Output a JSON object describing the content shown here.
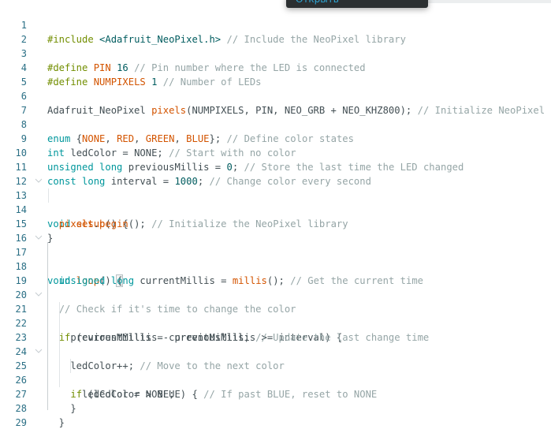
{
  "tooltip": {
    "label": "Открыть"
  },
  "editor": {
    "lines": [
      {
        "n": "1"
      },
      {
        "n": "2"
      },
      {
        "n": "3"
      },
      {
        "n": "4"
      },
      {
        "n": "5"
      },
      {
        "n": "6"
      },
      {
        "n": "7"
      },
      {
        "n": "8"
      },
      {
        "n": "9"
      },
      {
        "n": "10"
      },
      {
        "n": "11"
      },
      {
        "n": "12"
      },
      {
        "n": "13"
      },
      {
        "n": "14"
      },
      {
        "n": "15"
      },
      {
        "n": "16"
      },
      {
        "n": "17"
      },
      {
        "n": "18"
      },
      {
        "n": "19"
      },
      {
        "n": "20"
      },
      {
        "n": "21"
      },
      {
        "n": "22"
      },
      {
        "n": "23"
      },
      {
        "n": "24"
      },
      {
        "n": "25"
      },
      {
        "n": "26"
      },
      {
        "n": "27"
      },
      {
        "n": "28"
      },
      {
        "n": "29"
      }
    ],
    "code": {
      "l1": {
        "a": "#include",
        "b": " <Adafruit_NeoPixel.h>",
        "c": " // Include the NeoPixel library"
      },
      "l3": {
        "a": "#define",
        "b": " PIN",
        "c": " 16",
        "d": " // Pin number where the LED is connected"
      },
      "l4": {
        "a": "#define",
        "b": " NUMPIXELS",
        "c": " 1",
        "d": " // Number of LEDs"
      },
      "l6": {
        "a": "Adafruit_NeoPixel ",
        "b": "pixels",
        "c": "(NUMPIXELS, PIN, NEO_GRB + NEO_KHZ800);",
        "d": " // Initialize NeoPixel"
      },
      "l8": {
        "a": "enum",
        "b": " {",
        "c1": "NONE",
        "s1": ", ",
        "c2": "RED",
        "s2": ", ",
        "c3": "GREEN",
        "s3": ", ",
        "c4": "BLUE",
        "e": "};",
        "d": " // Define color states"
      },
      "l9": {
        "a": "int",
        "b": " ledColor = NONE;",
        "d": " // Start with no color"
      },
      "l10": {
        "a": "unsigned",
        "b": " ",
        "c": "long",
        "e": " previousMillis = ",
        "f": "0",
        "g": ";",
        "d": " // Store the last time the LED changed"
      },
      "l11": {
        "a": "const",
        "b": " ",
        "c": "long",
        "e": " interval = ",
        "f": "1000",
        "g": ";",
        "d": " // Change color every second"
      },
      "l13": {
        "a": "void",
        "b": " ",
        "c": "setup",
        "e": "() {"
      },
      "l14": {
        "a": "  ",
        "b": "pixels",
        "c": ".",
        "e": "begin",
        "f": "();",
        "d": " // Initialize the NeoPixel library"
      },
      "l15": {
        "a": "}"
      },
      "l17": {
        "a": "void",
        "b": " ",
        "c": "loop",
        "e": "() ",
        "f": "{"
      },
      "l18": {
        "a": "  ",
        "b": "unsigned",
        "c": " ",
        "e": "long",
        "f": " currentMillis = ",
        "g": "millis",
        "h": "();",
        "d": " // Get the current time"
      },
      "l20": {
        "a": "  ",
        "d": "// Check if it's time to change the color"
      },
      "l21": {
        "a": "  ",
        "b": "if",
        "c": " (currentMillis - previousMillis >= interval) {"
      },
      "l22": {
        "a": "    previousMillis = currentMillis;",
        "d": " // Update the last change time"
      },
      "l24": {
        "a": "    ledColor++;",
        "d": " // Move to the next color"
      },
      "l25": {
        "a": "    ",
        "b": "if",
        "c": " (ledColor > BLUE) {",
        "d": " // If past BLUE, reset to NONE"
      },
      "l26": {
        "a": "      ledColor = NONE;"
      },
      "l27": {
        "a": "    }"
      },
      "l28": {
        "a": "  }"
      }
    }
  }
}
